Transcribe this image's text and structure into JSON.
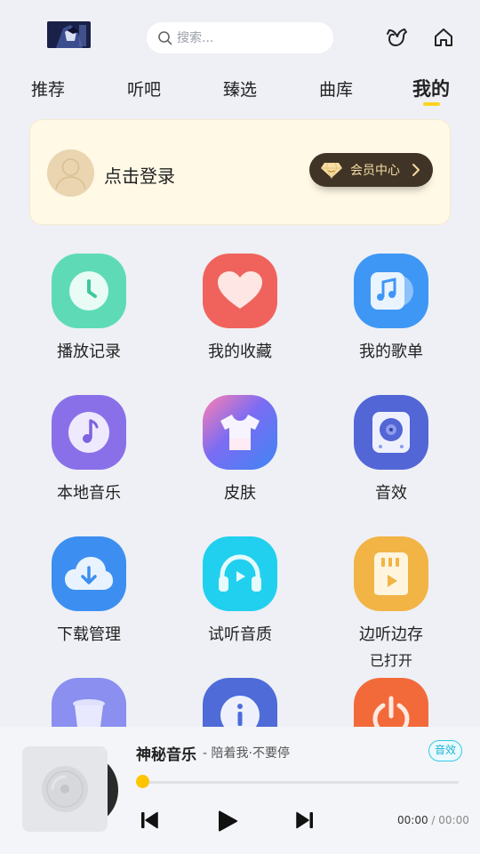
{
  "header": {
    "search_placeholder": "搜索...",
    "icons": [
      "bird-icon",
      "home-icon"
    ]
  },
  "tabs": [
    {
      "label": "推荐"
    },
    {
      "label": "听吧"
    },
    {
      "label": "臻选"
    },
    {
      "label": "曲库"
    },
    {
      "label": "我的",
      "active": true
    }
  ],
  "login_card": {
    "login_text": "点击登录",
    "vip_label": "会员中心"
  },
  "grid": [
    {
      "label": "播放记录",
      "icon": "clock-icon",
      "color": "#5bd8b4"
    },
    {
      "label": "我的收藏",
      "icon": "heart-icon",
      "color": "#f0635c"
    },
    {
      "label": "我的歌单",
      "icon": "music-note-icon",
      "color": "#3f97f5"
    },
    {
      "label": "本地音乐",
      "icon": "disc-note-icon",
      "color": "#8a70e8"
    },
    {
      "label": "皮肤",
      "icon": "tshirt-icon",
      "color": "#6b6cf2"
    },
    {
      "label": "音效",
      "icon": "speaker-icon",
      "color": "#5266d6"
    },
    {
      "label": "下载管理",
      "icon": "cloud-download-icon",
      "color": "#3c8ff0"
    },
    {
      "label": "试听音质",
      "icon": "headphones-icon",
      "color": "#21d0ee"
    },
    {
      "label": "边听边存",
      "sub": "已打开",
      "icon": "sd-card-icon",
      "color": "#f2b445"
    },
    {
      "label": "",
      "icon": "trash-icon",
      "color": "#8a8ff0"
    },
    {
      "label": "",
      "icon": "info-icon",
      "color": "#4e6bd8"
    },
    {
      "label": "",
      "icon": "power-icon",
      "color": "#f26a3a"
    }
  ],
  "player": {
    "title": "神秘音乐",
    "artist": "- 陪着我·不要停",
    "effect_label": "音效",
    "time_current": "00:00",
    "time_separator": " / ",
    "time_total": "00:00",
    "progress": 0
  }
}
